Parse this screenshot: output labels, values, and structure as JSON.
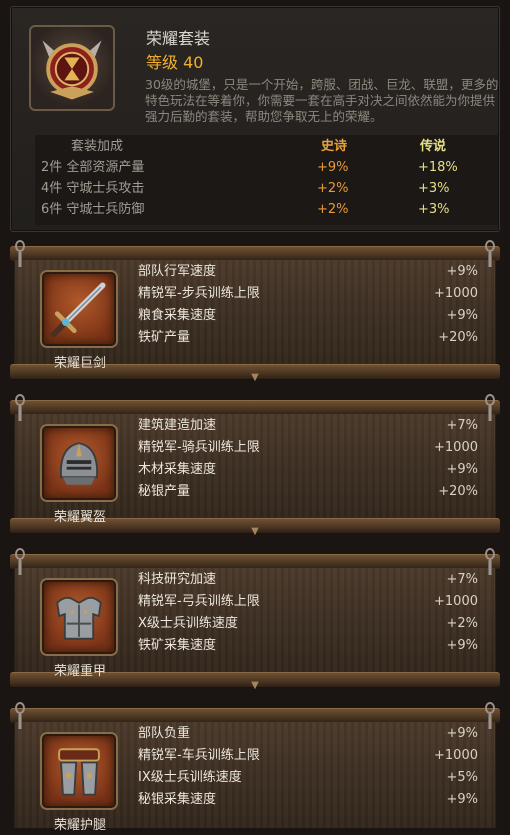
{
  "header": {
    "title": "荣耀套装",
    "level": "等级 40",
    "description": "30级的城堡，只是一个开始，跨服、团战、巨龙、联盟，更多的特色玩法在等着你，你需要一套在高手对决之间依然能为你提供强力后勤的套装，帮助您争取无上的荣耀。",
    "bonus_table": {
      "headers": [
        "套装加成",
        "史诗",
        "传说"
      ],
      "rows": [
        [
          "2件 全部资源产量",
          "+9%",
          "+18%"
        ],
        [
          "4件 守城士兵攻击",
          "+2%",
          "+3%"
        ],
        [
          "6件 守城士兵防御",
          "+2%",
          "+3%"
        ]
      ]
    }
  },
  "items": [
    {
      "name": "荣耀巨剑",
      "icon": "sword-icon",
      "stats": [
        [
          "部队行军速度",
          "+9%"
        ],
        [
          "精锐军-步兵训练上限",
          "+1000"
        ],
        [
          "粮食采集速度",
          "+9%"
        ],
        [
          "铁矿产量",
          "+20%"
        ]
      ]
    },
    {
      "name": "荣耀翼盔",
      "icon": "helmet-icon",
      "stats": [
        [
          "建筑建造加速",
          "+7%"
        ],
        [
          "精锐军-骑兵训练上限",
          "+1000"
        ],
        [
          "木材采集速度",
          "+9%"
        ],
        [
          "秘银产量",
          "+20%"
        ]
      ]
    },
    {
      "name": "荣耀重甲",
      "icon": "armor-icon",
      "stats": [
        [
          "科技研究加速",
          "+7%"
        ],
        [
          "精锐军-弓兵训练上限",
          "+1000"
        ],
        [
          "X级士兵训练速度",
          "+2%"
        ],
        [
          "铁矿采集速度",
          "+9%"
        ]
      ]
    },
    {
      "name": "荣耀护腿",
      "icon": "greaves-icon",
      "stats": [
        [
          "部队负重",
          "+9%"
        ],
        [
          "精锐军-车兵训练上限",
          "+1000"
        ],
        [
          "IX级士兵训练速度",
          "+5%"
        ],
        [
          "秘银采集速度",
          "+9%"
        ]
      ]
    }
  ],
  "colors": {
    "level": "#f0b02a",
    "epic": "#e89a3a",
    "legendary": "#e6df8a"
  }
}
